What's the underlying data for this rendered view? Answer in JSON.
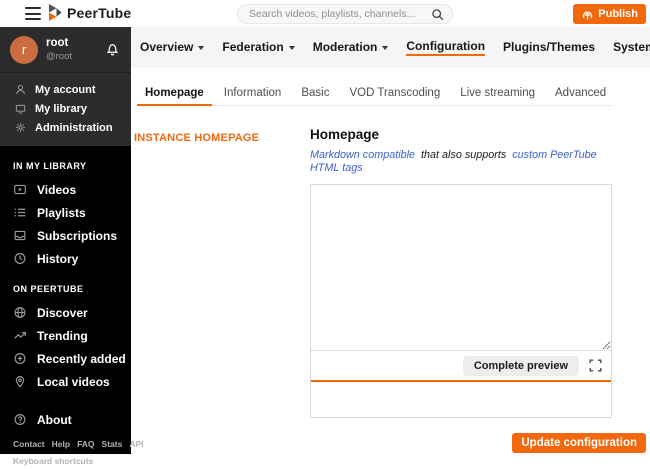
{
  "topbar": {
    "brand": "PeerTube",
    "search_placeholder": "Search videos, playlists, channels...",
    "publish_label": "Publish"
  },
  "sidebar": {
    "user": {
      "initial": "r",
      "name": "root",
      "handle": "@root"
    },
    "account_items": [
      {
        "label": "My account"
      },
      {
        "label": "My library"
      },
      {
        "label": "Administration"
      }
    ],
    "sections": [
      {
        "title": "IN MY LIBRARY",
        "items": [
          {
            "label": "Videos"
          },
          {
            "label": "Playlists"
          },
          {
            "label": "Subscriptions"
          },
          {
            "label": "History"
          }
        ]
      },
      {
        "title": "ON PEERTUBE",
        "items": [
          {
            "label": "Discover"
          },
          {
            "label": "Trending"
          },
          {
            "label": "Recently added"
          },
          {
            "label": "Local videos"
          }
        ]
      }
    ],
    "about_label": "About",
    "footer_links": [
      "Contact",
      "Help",
      "FAQ",
      "Stats",
      "API"
    ],
    "footer_links_row2": [
      "Keyboard shortcuts"
    ]
  },
  "admin_nav": {
    "items": [
      {
        "label": "Overview"
      },
      {
        "label": "Federation"
      },
      {
        "label": "Moderation"
      },
      {
        "label": "Configuration"
      },
      {
        "label": "Plugins/Themes"
      },
      {
        "label": "System"
      }
    ]
  },
  "config_tabs": {
    "items": [
      {
        "label": "Homepage"
      },
      {
        "label": "Information"
      },
      {
        "label": "Basic"
      },
      {
        "label": "VOD Transcoding"
      },
      {
        "label": "Live streaming"
      },
      {
        "label": "Advanced"
      }
    ]
  },
  "homepage_form": {
    "section_label": "INSTANCE HOMEPAGE",
    "field_label": "Homepage",
    "hint_link_1": "Markdown compatible",
    "hint_middle": "that also supports",
    "hint_link_2": "custom PeerTube HTML tags",
    "textarea_value": "",
    "preview_button_label": "Complete preview",
    "submit_label": "Update configuration"
  },
  "colors": {
    "accent_orange": "#F1680D",
    "link_blue": "#3A62C9",
    "avatar_orange": "#CB6D40"
  }
}
